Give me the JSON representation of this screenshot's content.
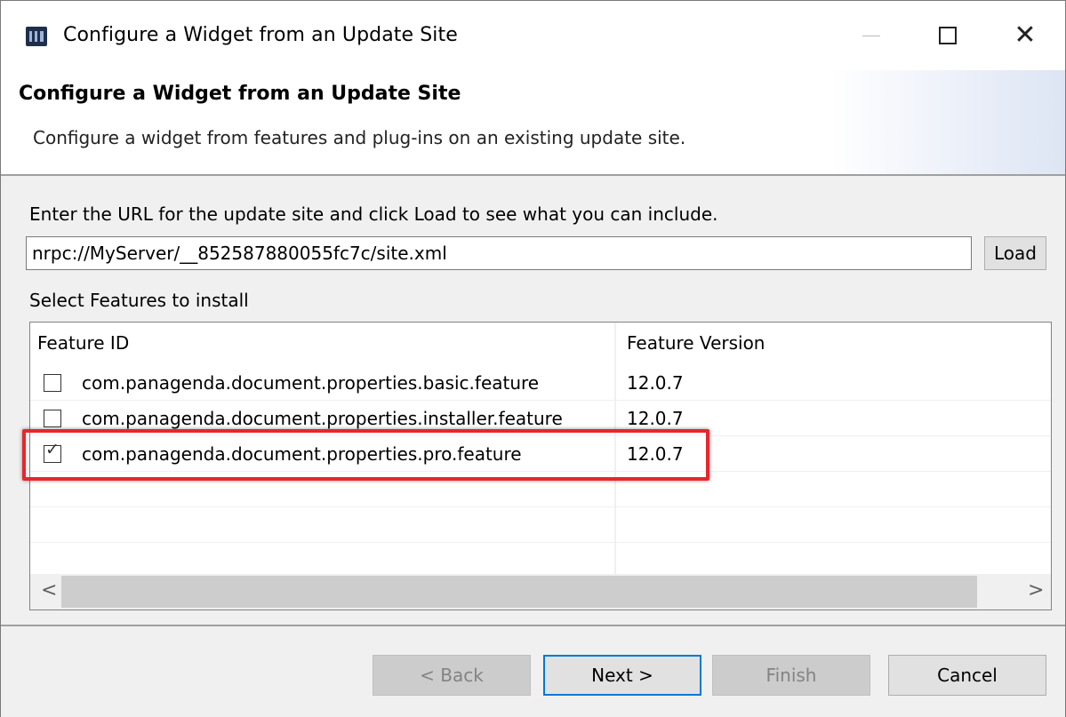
{
  "window": {
    "title": "Configure a Widget from an Update Site",
    "controls": {
      "minimize": "—",
      "maximize": "☐",
      "close": "✕"
    }
  },
  "banner": {
    "title": "Configure a Widget from an Update Site",
    "description": "Configure a widget from features and plug-ins on an existing update site."
  },
  "url_section": {
    "label": "Enter the URL for the update site and click Load to see what you can include.",
    "url_value": "nrpc://MyServer/__852587880055fc7c/site.xml",
    "load_label": "Load"
  },
  "features": {
    "label": "Select Features to install",
    "columns": [
      "Feature ID",
      "Feature Version"
    ],
    "rows": [
      {
        "id": "com.panagenda.document.properties.basic.feature",
        "version": "12.0.7",
        "checked": false
      },
      {
        "id": "com.panagenda.document.properties.installer.feature",
        "version": "12.0.7",
        "checked": false
      },
      {
        "id": "com.panagenda.document.properties.pro.feature",
        "version": "12.0.7",
        "checked": true
      }
    ]
  },
  "scrollbar": {
    "left_arrow": "<",
    "right_arrow": ">"
  },
  "buttons": {
    "back": "< Back",
    "next": "Next >",
    "finish": "Finish",
    "cancel": "Cancel"
  },
  "colors": {
    "highlight": "#e8262b",
    "default_button_border": "#0078d7",
    "dialog_background": "#f0f0f0"
  },
  "icons": {
    "app": "widget-app-icon",
    "checked": "checkmark-icon"
  }
}
